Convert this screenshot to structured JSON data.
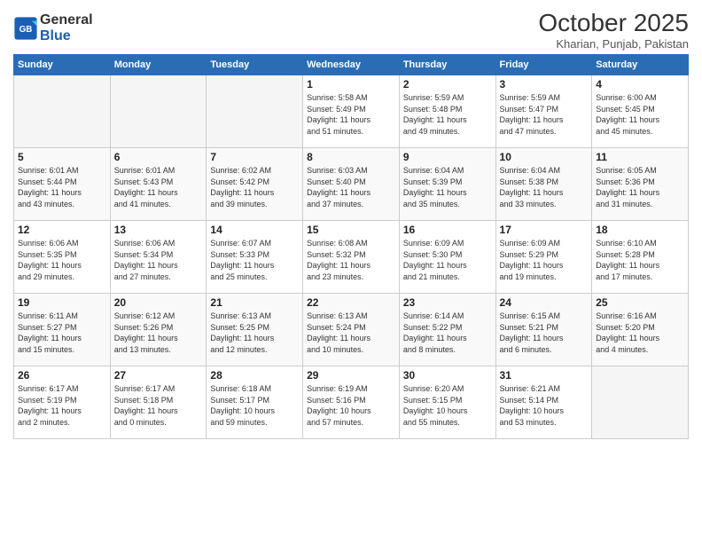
{
  "logo": {
    "text_general": "General",
    "text_blue": "Blue"
  },
  "title": "October 2025",
  "location": "Kharian, Punjab, Pakistan",
  "days_of_week": [
    "Sunday",
    "Monday",
    "Tuesday",
    "Wednesday",
    "Thursday",
    "Friday",
    "Saturday"
  ],
  "weeks": [
    [
      {
        "day": "",
        "info": ""
      },
      {
        "day": "",
        "info": ""
      },
      {
        "day": "",
        "info": ""
      },
      {
        "day": "1",
        "info": "Sunrise: 5:58 AM\nSunset: 5:49 PM\nDaylight: 11 hours\nand 51 minutes."
      },
      {
        "day": "2",
        "info": "Sunrise: 5:59 AM\nSunset: 5:48 PM\nDaylight: 11 hours\nand 49 minutes."
      },
      {
        "day": "3",
        "info": "Sunrise: 5:59 AM\nSunset: 5:47 PM\nDaylight: 11 hours\nand 47 minutes."
      },
      {
        "day": "4",
        "info": "Sunrise: 6:00 AM\nSunset: 5:45 PM\nDaylight: 11 hours\nand 45 minutes."
      }
    ],
    [
      {
        "day": "5",
        "info": "Sunrise: 6:01 AM\nSunset: 5:44 PM\nDaylight: 11 hours\nand 43 minutes."
      },
      {
        "day": "6",
        "info": "Sunrise: 6:01 AM\nSunset: 5:43 PM\nDaylight: 11 hours\nand 41 minutes."
      },
      {
        "day": "7",
        "info": "Sunrise: 6:02 AM\nSunset: 5:42 PM\nDaylight: 11 hours\nand 39 minutes."
      },
      {
        "day": "8",
        "info": "Sunrise: 6:03 AM\nSunset: 5:40 PM\nDaylight: 11 hours\nand 37 minutes."
      },
      {
        "day": "9",
        "info": "Sunrise: 6:04 AM\nSunset: 5:39 PM\nDaylight: 11 hours\nand 35 minutes."
      },
      {
        "day": "10",
        "info": "Sunrise: 6:04 AM\nSunset: 5:38 PM\nDaylight: 11 hours\nand 33 minutes."
      },
      {
        "day": "11",
        "info": "Sunrise: 6:05 AM\nSunset: 5:36 PM\nDaylight: 11 hours\nand 31 minutes."
      }
    ],
    [
      {
        "day": "12",
        "info": "Sunrise: 6:06 AM\nSunset: 5:35 PM\nDaylight: 11 hours\nand 29 minutes."
      },
      {
        "day": "13",
        "info": "Sunrise: 6:06 AM\nSunset: 5:34 PM\nDaylight: 11 hours\nand 27 minutes."
      },
      {
        "day": "14",
        "info": "Sunrise: 6:07 AM\nSunset: 5:33 PM\nDaylight: 11 hours\nand 25 minutes."
      },
      {
        "day": "15",
        "info": "Sunrise: 6:08 AM\nSunset: 5:32 PM\nDaylight: 11 hours\nand 23 minutes."
      },
      {
        "day": "16",
        "info": "Sunrise: 6:09 AM\nSunset: 5:30 PM\nDaylight: 11 hours\nand 21 minutes."
      },
      {
        "day": "17",
        "info": "Sunrise: 6:09 AM\nSunset: 5:29 PM\nDaylight: 11 hours\nand 19 minutes."
      },
      {
        "day": "18",
        "info": "Sunrise: 6:10 AM\nSunset: 5:28 PM\nDaylight: 11 hours\nand 17 minutes."
      }
    ],
    [
      {
        "day": "19",
        "info": "Sunrise: 6:11 AM\nSunset: 5:27 PM\nDaylight: 11 hours\nand 15 minutes."
      },
      {
        "day": "20",
        "info": "Sunrise: 6:12 AM\nSunset: 5:26 PM\nDaylight: 11 hours\nand 13 minutes."
      },
      {
        "day": "21",
        "info": "Sunrise: 6:13 AM\nSunset: 5:25 PM\nDaylight: 11 hours\nand 12 minutes."
      },
      {
        "day": "22",
        "info": "Sunrise: 6:13 AM\nSunset: 5:24 PM\nDaylight: 11 hours\nand 10 minutes."
      },
      {
        "day": "23",
        "info": "Sunrise: 6:14 AM\nSunset: 5:22 PM\nDaylight: 11 hours\nand 8 minutes."
      },
      {
        "day": "24",
        "info": "Sunrise: 6:15 AM\nSunset: 5:21 PM\nDaylight: 11 hours\nand 6 minutes."
      },
      {
        "day": "25",
        "info": "Sunrise: 6:16 AM\nSunset: 5:20 PM\nDaylight: 11 hours\nand 4 minutes."
      }
    ],
    [
      {
        "day": "26",
        "info": "Sunrise: 6:17 AM\nSunset: 5:19 PM\nDaylight: 11 hours\nand 2 minutes."
      },
      {
        "day": "27",
        "info": "Sunrise: 6:17 AM\nSunset: 5:18 PM\nDaylight: 11 hours\nand 0 minutes."
      },
      {
        "day": "28",
        "info": "Sunrise: 6:18 AM\nSunset: 5:17 PM\nDaylight: 10 hours\nand 59 minutes."
      },
      {
        "day": "29",
        "info": "Sunrise: 6:19 AM\nSunset: 5:16 PM\nDaylight: 10 hours\nand 57 minutes."
      },
      {
        "day": "30",
        "info": "Sunrise: 6:20 AM\nSunset: 5:15 PM\nDaylight: 10 hours\nand 55 minutes."
      },
      {
        "day": "31",
        "info": "Sunrise: 6:21 AM\nSunset: 5:14 PM\nDaylight: 10 hours\nand 53 minutes."
      },
      {
        "day": "",
        "info": ""
      }
    ]
  ]
}
